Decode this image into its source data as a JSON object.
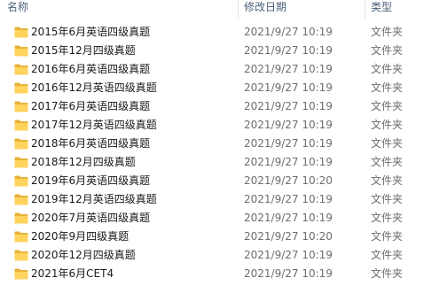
{
  "columns": {
    "name": "名称",
    "date": "修改日期",
    "type": "类型"
  },
  "files": [
    {
      "name": "2015年6月英语四级真题",
      "date": "2021/9/27 10:19",
      "type": "文件夹"
    },
    {
      "name": "2015年12月四级真题",
      "date": "2021/9/27 10:19",
      "type": "文件夹"
    },
    {
      "name": "2016年6月英语四级真题",
      "date": "2021/9/27 10:19",
      "type": "文件夹"
    },
    {
      "name": "2016年12月英语四级真题",
      "date": "2021/9/27 10:19",
      "type": "文件夹"
    },
    {
      "name": "2017年6月英语四级真题",
      "date": "2021/9/27 10:19",
      "type": "文件夹"
    },
    {
      "name": "2017年12月英语四级真题",
      "date": "2021/9/27 10:19",
      "type": "文件夹"
    },
    {
      "name": "2018年6月英语四级真题",
      "date": "2021/9/27 10:19",
      "type": "文件夹"
    },
    {
      "name": "2018年12月四级真题",
      "date": "2021/9/27 10:19",
      "type": "文件夹"
    },
    {
      "name": "2019年6月英语四级真题",
      "date": "2021/9/27 10:20",
      "type": "文件夹"
    },
    {
      "name": "2019年12月英语四级真题",
      "date": "2021/9/27 10:19",
      "type": "文件夹"
    },
    {
      "name": "2020年7月英语四级真题",
      "date": "2021/9/27 10:19",
      "type": "文件夹"
    },
    {
      "name": "2020年9月四级真题",
      "date": "2021/9/27 10:20",
      "type": "文件夹"
    },
    {
      "name": "2020年12月四级真题",
      "date": "2021/9/27 10:19",
      "type": "文件夹"
    },
    {
      "name": "2021年6月CET4",
      "date": "2021/9/27 10:19",
      "type": "文件夹"
    }
  ],
  "icon": "folder-icon",
  "colors": {
    "folder_back": "#e8b23a",
    "folder_front": "#ffd35c",
    "header_text": "#4c607a",
    "secondary_text": "#6d6d6d"
  }
}
